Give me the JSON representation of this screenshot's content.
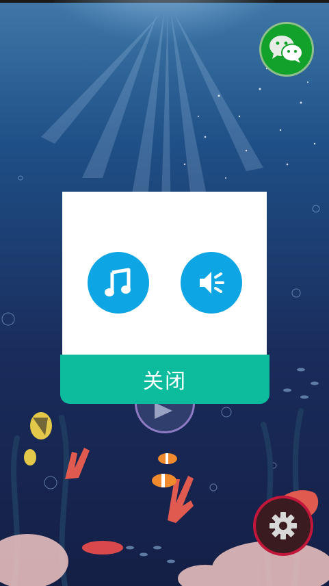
{
  "modal": {
    "close_label": "关闭"
  },
  "icons": {
    "wechat": "wechat-icon",
    "music": "music-note-icon",
    "sound": "speaker-icon",
    "settings": "gear-icon",
    "play": "play-icon"
  },
  "colors": {
    "modal_accent": "#0dbc9c",
    "toggle_blue": "#0ea5e4",
    "wechat_green": "#12a12a",
    "settings_ring": "#c2163a"
  }
}
